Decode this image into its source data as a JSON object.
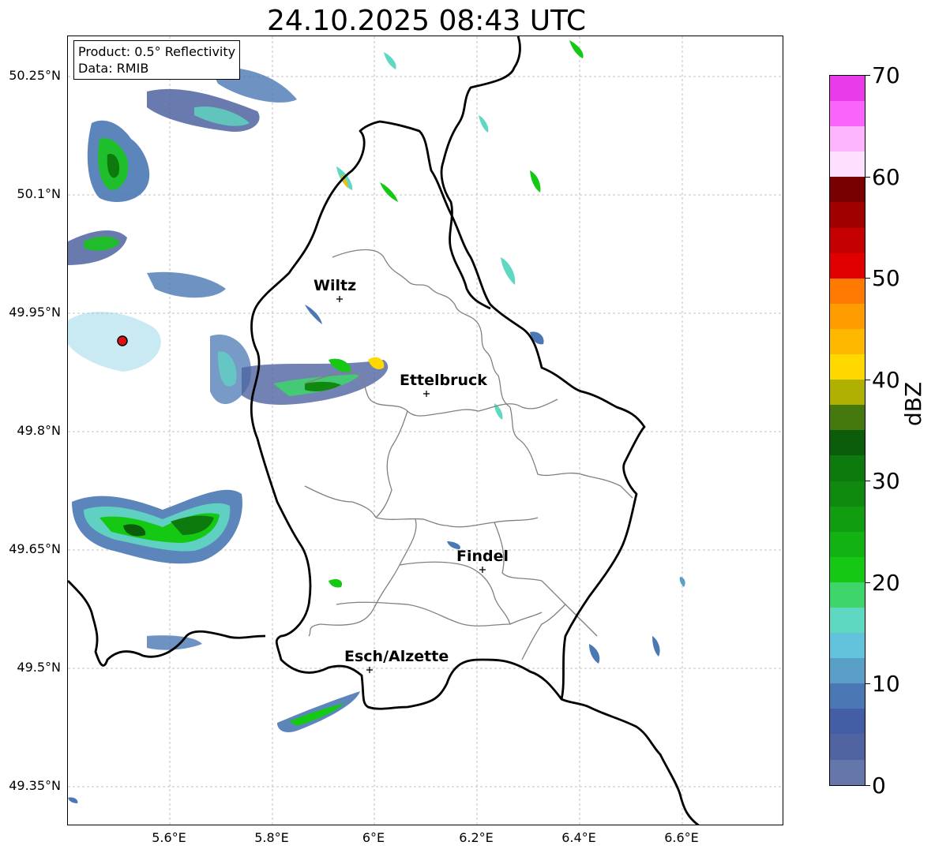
{
  "title": "24.10.2025 08:43 UTC",
  "info": {
    "product": "Product: 0.5° Reflectivity",
    "source": "Data: RMIB"
  },
  "axes": {
    "lat_labels": [
      "50.25°N",
      "50.1°N",
      "49.95°N",
      "49.8°N",
      "49.65°N",
      "49.5°N",
      "49.35°N"
    ],
    "lon_labels": [
      "5.6°E",
      "5.8°E",
      "6°E",
      "6.2°E",
      "6.4°E",
      "6.6°E"
    ]
  },
  "cities": [
    {
      "name": "Wiltz"
    },
    {
      "name": "Ettelbruck"
    },
    {
      "name": "Findel"
    },
    {
      "name": "Esch/Alzette"
    }
  ],
  "colorbar": {
    "unit": "dBZ",
    "tick_labels": [
      "70",
      "60",
      "50",
      "40",
      "30",
      "20",
      "10",
      "0"
    ],
    "min": 0,
    "max": 70,
    "step": 2.5,
    "colors_top_to_bottom": [
      "#e83ae8",
      "#fa64fa",
      "#fcb4fc",
      "#fde0fd",
      "#780000",
      "#a00000",
      "#c40000",
      "#e00000",
      "#ff7a00",
      "#ff9c00",
      "#ffb800",
      "#ffd800",
      "#afb000",
      "#45780d",
      "#0b5c0b",
      "#0d7a0d",
      "#0f8a0f",
      "#109e10",
      "#12b212",
      "#14c814",
      "#3ed66a",
      "#5fd8c2",
      "#63c2dc",
      "#5a9fc8",
      "#4a78b4",
      "#435ea4",
      "#4f64a0",
      "#6577aa"
    ]
  },
  "radar_site_color": "#e01010"
}
